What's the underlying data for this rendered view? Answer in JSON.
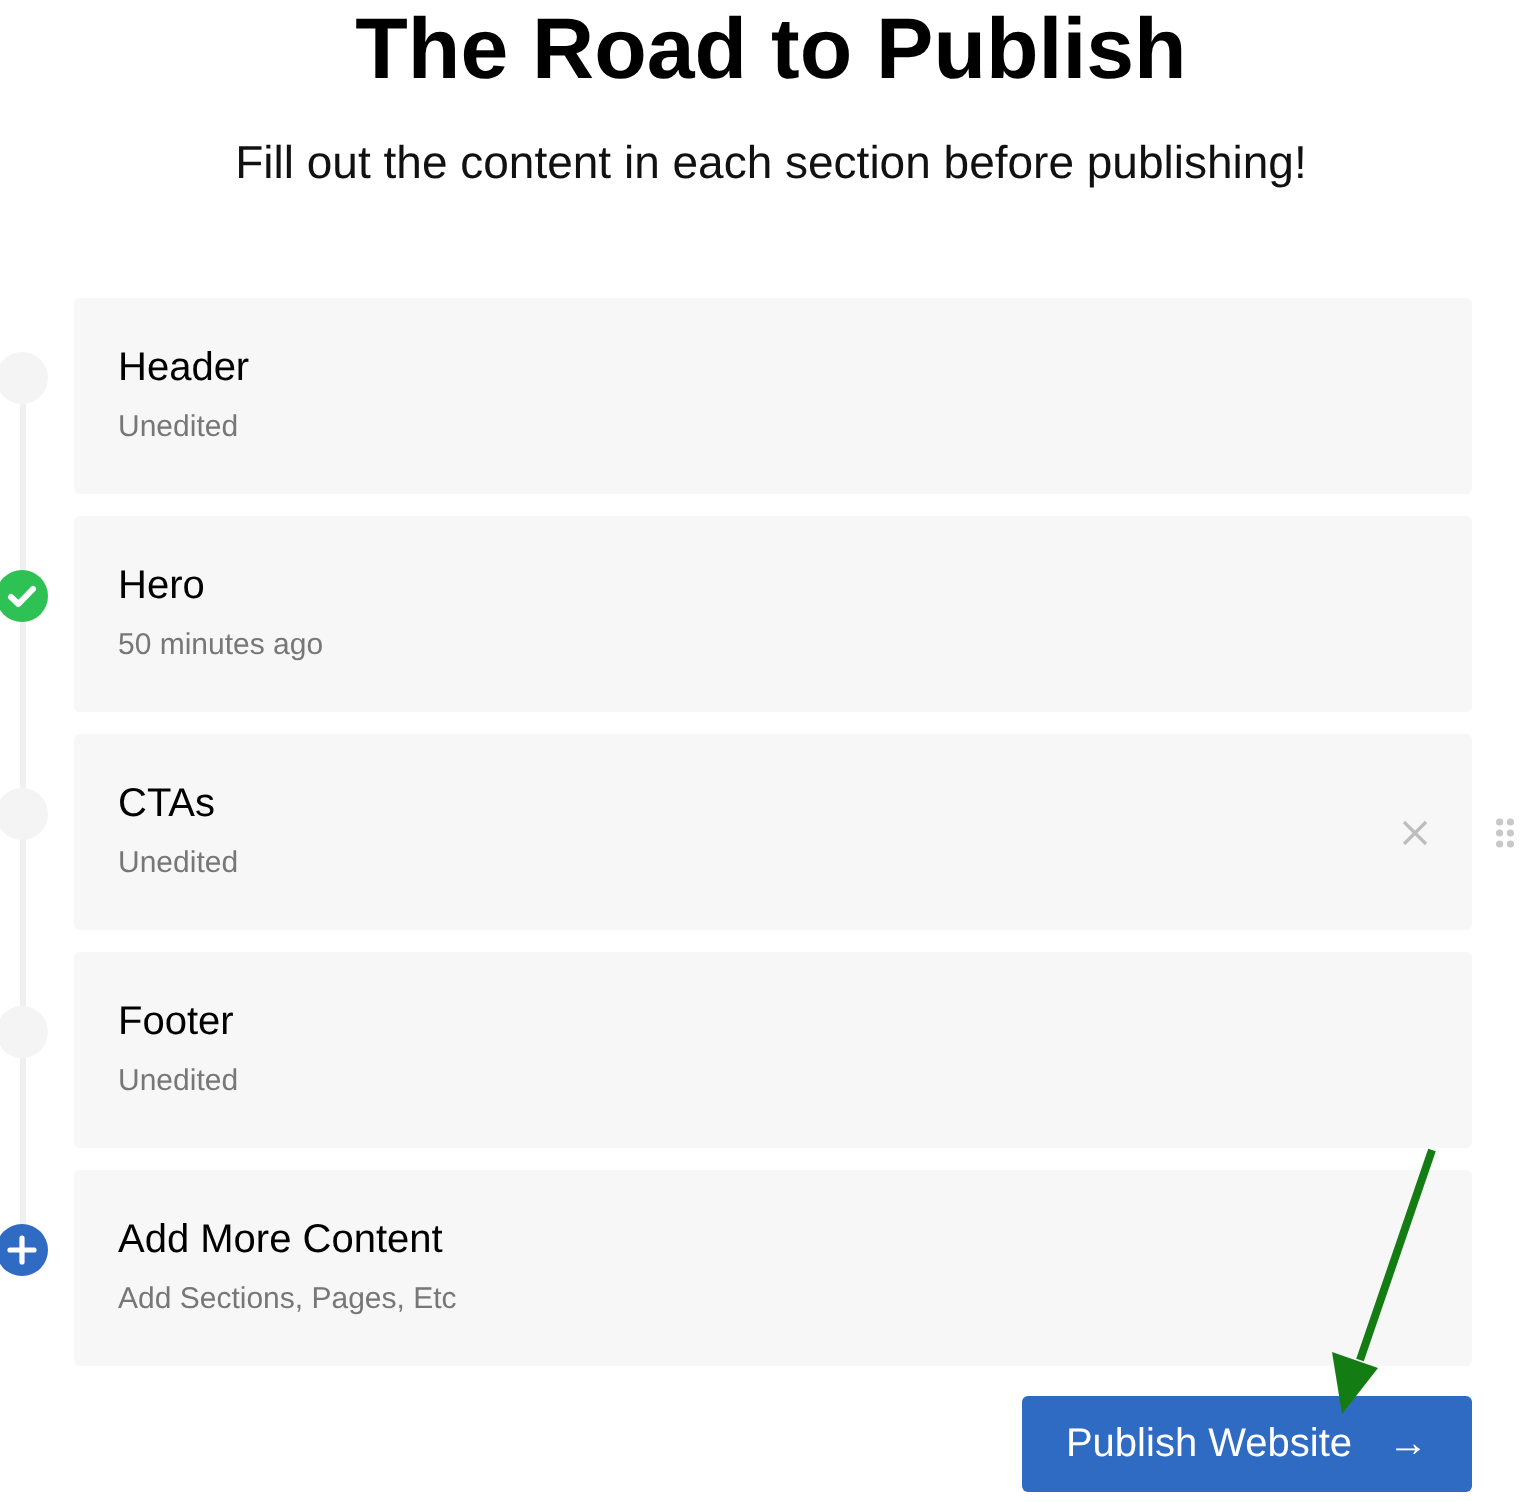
{
  "title": "The Road to Publish",
  "subtitle": "Fill out the content in each section before publishing!",
  "sections": [
    {
      "kind": "pending",
      "title": "Header",
      "status": "Unedited",
      "hovered": false
    },
    {
      "kind": "done",
      "title": "Hero",
      "status": "50 minutes ago",
      "hovered": false
    },
    {
      "kind": "pending",
      "title": "CTAs",
      "status": "Unedited",
      "hovered": true
    },
    {
      "kind": "pending",
      "title": "Footer",
      "status": "Unedited",
      "hovered": false
    },
    {
      "kind": "add",
      "title": "Add More Content",
      "status": "Add Sections, Pages, Etc",
      "hovered": false
    }
  ],
  "publish_button": {
    "label": "Publish Website",
    "arrow": "→"
  }
}
